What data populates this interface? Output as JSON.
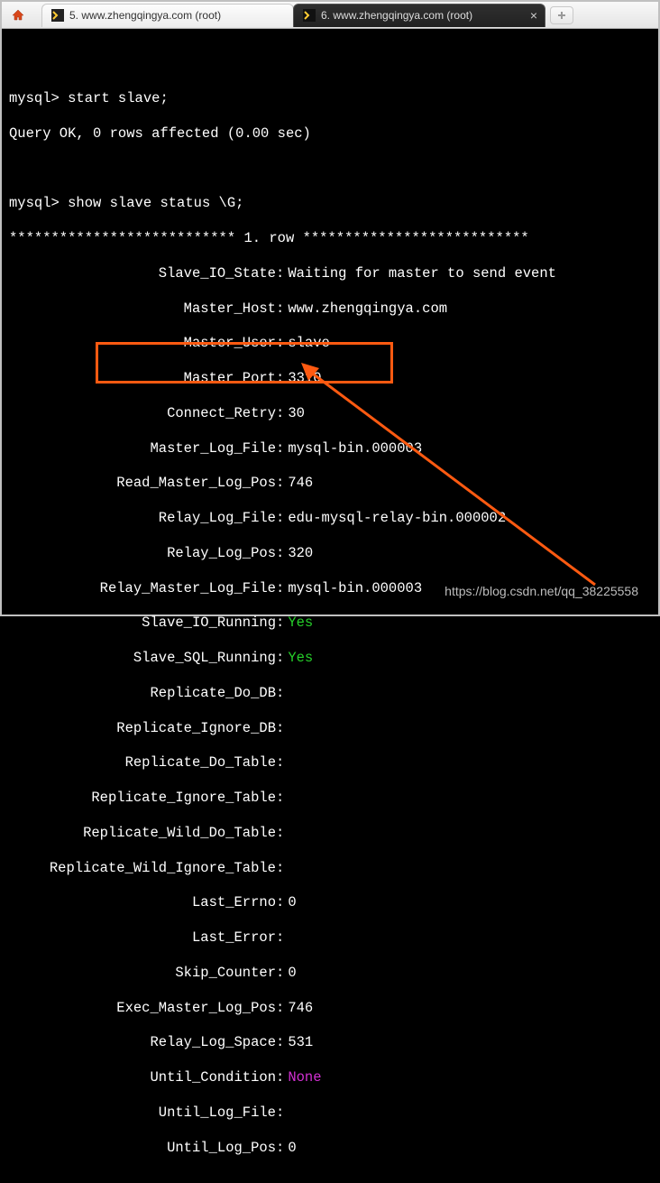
{
  "tabs": {
    "tab1": {
      "index": "5.",
      "label": "www.zhengqingya.com (root)"
    },
    "tab2": {
      "index": "6.",
      "label": "www.zhengqingya.com (root)"
    }
  },
  "terminal": {
    "prompt": "mysql>",
    "cmd1": "start slave;",
    "reply1": "Query OK, 0 rows affected (0.00 sec)",
    "cmd2": "show slave status \\G;",
    "row_header_left": "***************************",
    "row_header_mid": " 1. row ",
    "row_header_right": "***************************"
  },
  "fields": {
    "slave_io_state": {
      "k": "Slave_IO_State",
      "v": "Waiting for master to send event"
    },
    "master_host": {
      "k": "Master_Host",
      "v": "www.zhengqingya.com"
    },
    "master_user": {
      "k": "Master_User",
      "v": "slave"
    },
    "master_port": {
      "k": "Master_Port",
      "v": "3310"
    },
    "connect_retry": {
      "k": "Connect_Retry",
      "v": "30"
    },
    "master_log_file": {
      "k": "Master_Log_File",
      "v": "mysql-bin.000003"
    },
    "read_master_log_pos": {
      "k": "Read_Master_Log_Pos",
      "v": "746"
    },
    "relay_log_file": {
      "k": "Relay_Log_File",
      "v": "edu-mysql-relay-bin.000002"
    },
    "relay_log_pos": {
      "k": "Relay_Log_Pos",
      "v": "320"
    },
    "relay_master_log_file": {
      "k": "Relay_Master_Log_File",
      "v": "mysql-bin.000003"
    },
    "slave_io_running": {
      "k": "Slave_IO_Running",
      "v": "Yes"
    },
    "slave_sql_running": {
      "k": "Slave_SQL_Running",
      "v": "Yes"
    },
    "replicate_do_db": {
      "k": "Replicate_Do_DB",
      "v": ""
    },
    "replicate_ignore_db": {
      "k": "Replicate_Ignore_DB",
      "v": ""
    },
    "replicate_do_table": {
      "k": "Replicate_Do_Table",
      "v": ""
    },
    "replicate_ignore_table": {
      "k": "Replicate_Ignore_Table",
      "v": ""
    },
    "replicate_wild_do_table": {
      "k": "Replicate_Wild_Do_Table",
      "v": ""
    },
    "replicate_wild_ignore_table": {
      "k": "Replicate_Wild_Ignore_Table",
      "v": ""
    },
    "last_errno": {
      "k": "Last_Errno",
      "v": "0"
    },
    "last_error": {
      "k": "Last_Error",
      "v": ""
    },
    "skip_counter": {
      "k": "Skip_Counter",
      "v": "0"
    },
    "exec_master_log_pos": {
      "k": "Exec_Master_Log_Pos",
      "v": "746"
    },
    "relay_log_space": {
      "k": "Relay_Log_Space",
      "v": "531"
    },
    "until_condition": {
      "k": "Until_Condition",
      "v": "None"
    },
    "until_log_file": {
      "k": "Until_Log_File",
      "v": ""
    },
    "until_log_pos": {
      "k": "Until_Log_Pos",
      "v": "0"
    }
  },
  "watermark": "https://blog.csdn.net/qq_38225558"
}
